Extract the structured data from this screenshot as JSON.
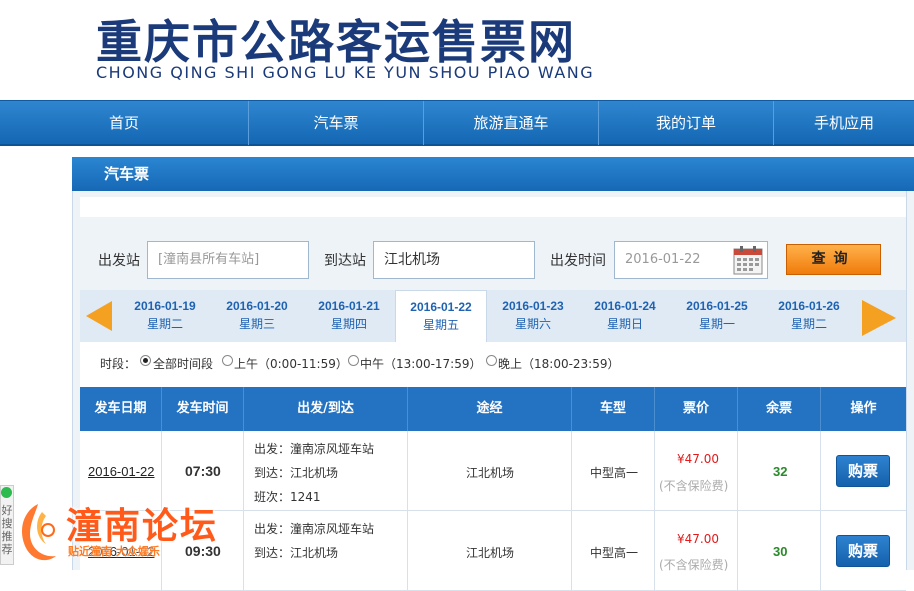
{
  "header": {
    "title_cn": "重庆市公路客运售票网",
    "title_en": "CHONG QING SHI GONG LU KE YUN SHOU PIAO WANG"
  },
  "nav": {
    "items": [
      "首页",
      "汽车票",
      "旅游直通车",
      "我的订单",
      "手机应用"
    ]
  },
  "section": {
    "title": "汽车票"
  },
  "search": {
    "from_label": "出发站",
    "from_placeholder": "[潼南县所有车站]",
    "to_label": "到达站",
    "to_value": "江北机场",
    "date_label": "出发时间",
    "date_value": "2016-01-22",
    "query_button": "查询"
  },
  "dates": [
    {
      "date": "2016-01-19",
      "weekday": "星期二"
    },
    {
      "date": "2016-01-20",
      "weekday": "星期三"
    },
    {
      "date": "2016-01-21",
      "weekday": "星期四"
    },
    {
      "date": "2016-01-22",
      "weekday": "星期五",
      "active": true
    },
    {
      "date": "2016-01-23",
      "weekday": "星期六"
    },
    {
      "date": "2016-01-24",
      "weekday": "星期日"
    },
    {
      "date": "2016-01-25",
      "weekday": "星期一"
    },
    {
      "date": "2016-01-26",
      "weekday": "星期二"
    }
  ],
  "period": {
    "label": "时段：",
    "options": [
      "全部时间段",
      "上午（0:00-11:59）",
      "中午（13:00-17:59）",
      "晚上（18:00-23:59）"
    ],
    "selected": 0
  },
  "table": {
    "headers": [
      "发车日期",
      "发车时间",
      "出发/到达",
      "途经",
      "车型",
      "票价",
      "余票",
      "操作"
    ],
    "rows": [
      {
        "date": "2016-01-22",
        "time": "07:30",
        "depart": "出发：潼南凉风垭车站",
        "arrive": "到达：江北机场",
        "trip": "班次：1241",
        "via": "江北机场",
        "bus_type": "中型高一",
        "price": "¥47.00",
        "price_note": "(不含保险费)",
        "seats": "32",
        "action": "购票"
      },
      {
        "date": "2016-01-22",
        "time": "09:30",
        "depart": "出发：潼南凉风垭车站",
        "arrive": "到达：江北机场",
        "trip": "",
        "via": "江北机场",
        "bus_type": "中型高一",
        "price": "¥47.00",
        "price_note": "(不含保险费)",
        "seats": "30",
        "action": "购票"
      }
    ]
  },
  "side_tab": {
    "text": "好搜推荐"
  },
  "watermark": {
    "title": "潼南论坛",
    "subtitle": "贴近潼南 大众娱乐"
  },
  "colors": {
    "brand_blue": "#1b3a7a",
    "nav_blue": "#1467b3",
    "accent_orange": "#f4a020",
    "price_red": "#e21b1b",
    "seats_green": "#2a8a2a"
  }
}
